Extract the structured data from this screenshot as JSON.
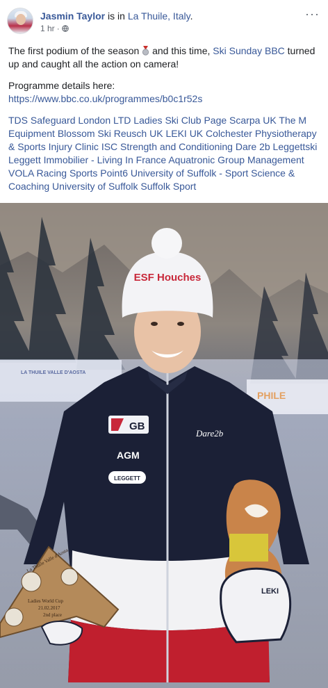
{
  "post": {
    "author": "Jasmin Taylor",
    "is_in": " is in ",
    "location": "La Thuile, Italy",
    "location_period": ".",
    "time": "1 hr",
    "dot": "·",
    "more": "···",
    "text_before_medal": "The first podium of the season ",
    "text_after_medal": " and this time, ",
    "linked_show": "Ski Sunday BBC",
    "text_after_show": " turned up and caught all the action on camera!",
    "programme_label": "Programme details here:",
    "programme_link": "https://www.bbc.co.uk/programmes/b0c1r52s",
    "tags": [
      "TDS Safeguard London LTD",
      "Ladies Ski Club",
      "Page Scarpa UK",
      "The M Equipment",
      "Blossom Ski",
      "Reusch UK",
      "LEKI UK",
      "Colchester Physiotherapy & Sports Injury Clinic",
      "ISC Strength and Conditioning",
      "Dare 2b",
      "Leggettski",
      "Leggett Immobilier - Living In France",
      "Aquatronic Group Management",
      "VOLA Racing",
      "Sports Point6",
      "University of Suffolk - Sport Science & Coaching",
      "University of Suffolk",
      "Suffolk Sport"
    ]
  },
  "photo": {
    "hat_text": "ESF Houches",
    "jacket_gb": "GB",
    "jacket_agm": "AGM",
    "jacket_leggett": "LEGGETT",
    "jacket_dare": "Dare2b",
    "glove_leki": "LEKI",
    "trophy_line1": "La Thuile Valle d'Aosta",
    "trophy_line2": "Ladies World Cup",
    "trophy_line3": "21.02.2017",
    "trophy_line4": "2nd place",
    "banner_left": "LA THUILE VALLE D'AOSTA",
    "banner_right": "PHILE"
  },
  "colors": {
    "link": "#385898",
    "meta": "#616770",
    "jacket_navy": "#1b2036",
    "jacket_red": "#c01f2e",
    "hat_white": "#f3f3f6"
  }
}
